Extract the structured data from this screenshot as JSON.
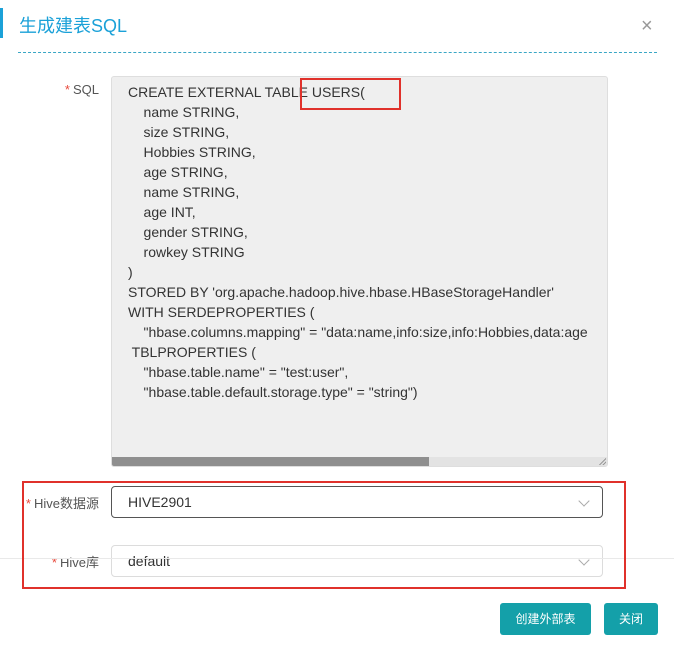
{
  "dialog": {
    "title": "生成建表SQL",
    "close_icon": "×"
  },
  "sql_field": {
    "required_mark": "*",
    "label": "SQL",
    "value": "CREATE EXTERNAL TABLE USERS(\n    name STRING,\n    size STRING,\n    Hobbies STRING,\n    age STRING,\n    name STRING,\n    age INT,\n    gender STRING,\n    rowkey STRING\n)\nSTORED BY 'org.apache.hadoop.hive.hbase.HBaseStorageHandler'\nWITH SERDEPROPERTIES (\n    \"hbase.columns.mapping\" = \"data:name,info:size,info:Hobbies,data:age\n TBLPROPERTIES (\n    \"hbase.table.name\" = \"test:user\",\n    \"hbase.table.default.storage.type\" = \"string\")",
    "hscroll_fraction": 0.64
  },
  "hive_source": {
    "required_mark": "*",
    "label": "Hive数据源",
    "value": "HIVE2901"
  },
  "hive_db": {
    "required_mark": "*",
    "label": "Hive库",
    "value": "default"
  },
  "footer": {
    "create_button": "创建外部表",
    "close_button": "关闭"
  },
  "colors": {
    "accent": "#1ba1d8",
    "primary_button": "#14a0a9",
    "highlight_box": "#e0312b",
    "required": "#e84a3c"
  }
}
